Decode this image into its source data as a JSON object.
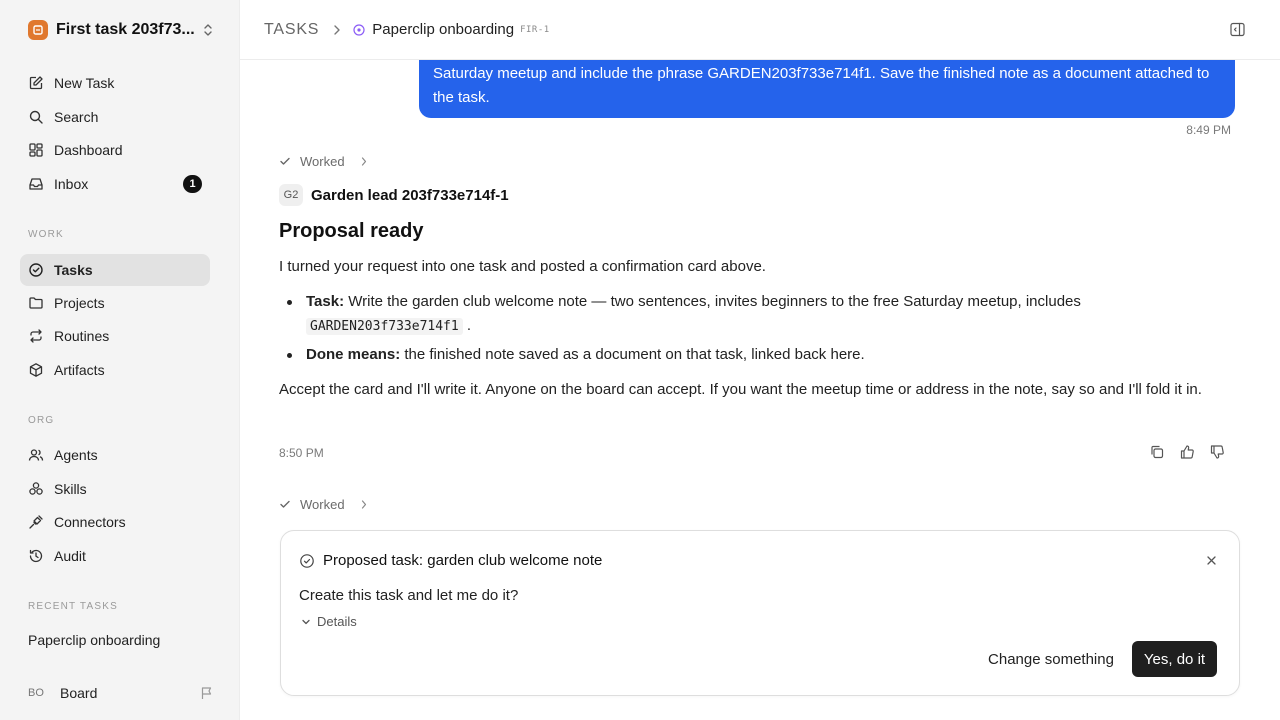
{
  "workspace": {
    "name": "First task 203f73..."
  },
  "sidebar": {
    "primary": [
      {
        "label": "New Task",
        "icon": "edit-icon"
      },
      {
        "label": "Search",
        "icon": "search-icon"
      },
      {
        "label": "Dashboard",
        "icon": "dashboard-icon"
      },
      {
        "label": "Inbox",
        "icon": "inbox-icon",
        "badge": "1"
      }
    ],
    "work_label": "WORK",
    "work": [
      {
        "label": "Tasks",
        "icon": "check-circle-icon",
        "active": true
      },
      {
        "label": "Projects",
        "icon": "folder-icon"
      },
      {
        "label": "Routines",
        "icon": "repeat-icon"
      },
      {
        "label": "Artifacts",
        "icon": "box-icon"
      }
    ],
    "org_label": "ORG",
    "org": [
      {
        "label": "Agents",
        "icon": "users-icon"
      },
      {
        "label": "Skills",
        "icon": "skills-icon"
      },
      {
        "label": "Connectors",
        "icon": "plug-icon"
      },
      {
        "label": "Audit",
        "icon": "history-icon"
      }
    ],
    "recent_label": "RECENT TASKS",
    "recent": [
      {
        "label": "Paperclip onboarding"
      }
    ],
    "footer": {
      "avatar": "BO",
      "name": "Board"
    }
  },
  "header": {
    "root": "TASKS",
    "title": "Paperclip onboarding",
    "id": "FIR-1",
    "status_color": "#8b5cf6"
  },
  "thread": {
    "user_message": "Saturday meetup and include the phrase GARDEN203f733e714f1. Save the finished note as a document attached to the task.",
    "user_time": "8:49 PM",
    "worked_label": "Worked",
    "agent": {
      "avatar": "G2",
      "name": "Garden lead 203f733e714f-1"
    },
    "title": "Proposal ready",
    "intro": "I turned your request into one task and posted a confirmation card above.",
    "bullet1_label": "Task:",
    "bullet1_text": "Write the garden club welcome note — two sentences, invites beginners to the free Saturday meetup, includes",
    "bullet1_code": "GARDEN203f733e714f1",
    "bullet1_end": ".",
    "bullet2_label": "Done means:",
    "bullet2_text": "the finished note saved as a document on that task, linked back here.",
    "outro": "Accept the card and I'll write it. Anyone on the board can accept. If you want the meetup time or address in the note, say so and I'll fold it in.",
    "agent_time": "8:50 PM",
    "worked_label_2": "Worked"
  },
  "card": {
    "title": "Proposed task: garden club welcome note",
    "question": "Create this task and let me do it?",
    "details": "Details",
    "secondary": "Change something",
    "primary": "Yes, do it"
  },
  "colors": {
    "accent": "#2563eb",
    "sidebar_bg": "#f4f4f4",
    "primary_btn": "#1f1f1f"
  }
}
